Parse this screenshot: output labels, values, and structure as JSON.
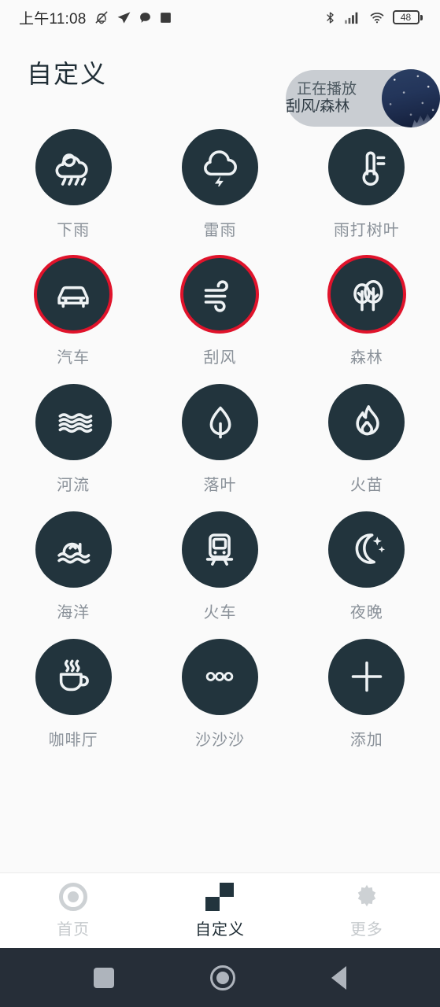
{
  "statusbar": {
    "time": "上午11:08",
    "left_icons": [
      "bell-muted-icon",
      "paper-plane-icon",
      "chat-bubble-icon",
      "square-notification-icon"
    ],
    "right_icons": [
      "bluetooth-icon",
      "cellular-signal-icon",
      "wifi-icon"
    ],
    "battery_percent": "48"
  },
  "header": {
    "title": "自定义",
    "now_playing": {
      "line1": "正在播放",
      "line2": "刮风/森林",
      "artwork": "starry-night-sky-thumbnail"
    }
  },
  "colors": {
    "page_background": "#fafafa",
    "disc": "#22343d",
    "selection_ring": "#e0132b",
    "label": "#8a9199",
    "title": "#1f2d35",
    "tabbar_background": "#ffffff",
    "navbar_background": "#262e38"
  },
  "grid": {
    "tiles": [
      {
        "label": "下雨",
        "icon": "rain-cloud-icon",
        "selected": false
      },
      {
        "label": "雷雨",
        "icon": "thunderstorm-icon",
        "selected": false
      },
      {
        "label": "雨打树叶",
        "icon": "thermometer-icon",
        "selected": false
      },
      {
        "label": "汽车",
        "icon": "car-icon",
        "selected": true
      },
      {
        "label": "刮风",
        "icon": "wind-icon",
        "selected": true
      },
      {
        "label": "森林",
        "icon": "trees-icon",
        "selected": true
      },
      {
        "label": "河流",
        "icon": "water-waves-icon",
        "selected": false
      },
      {
        "label": "落叶",
        "icon": "leaf-icon",
        "selected": false
      },
      {
        "label": "火苗",
        "icon": "flame-icon",
        "selected": false
      },
      {
        "label": "海洋",
        "icon": "ocean-wave-icon",
        "selected": false
      },
      {
        "label": "火车",
        "icon": "train-icon",
        "selected": false
      },
      {
        "label": "夜晚",
        "icon": "moon-stars-icon",
        "selected": false
      },
      {
        "label": "咖啡厅",
        "icon": "coffee-cup-icon",
        "selected": false
      },
      {
        "label": "沙沙沙",
        "icon": "three-dots-icon",
        "selected": false
      },
      {
        "label": "添加",
        "icon": "plus-icon",
        "selected": false
      }
    ]
  },
  "tabbar": {
    "tabs": [
      {
        "label": "首页",
        "icon": "home-circle-icon",
        "active": false
      },
      {
        "label": "自定义",
        "icon": "checkerboard-icon",
        "active": true
      },
      {
        "label": "更多",
        "icon": "gear-icon",
        "active": false
      }
    ]
  },
  "navbar": {
    "buttons": [
      "recents-square-icon",
      "home-circle-icon",
      "back-triangle-icon"
    ]
  }
}
